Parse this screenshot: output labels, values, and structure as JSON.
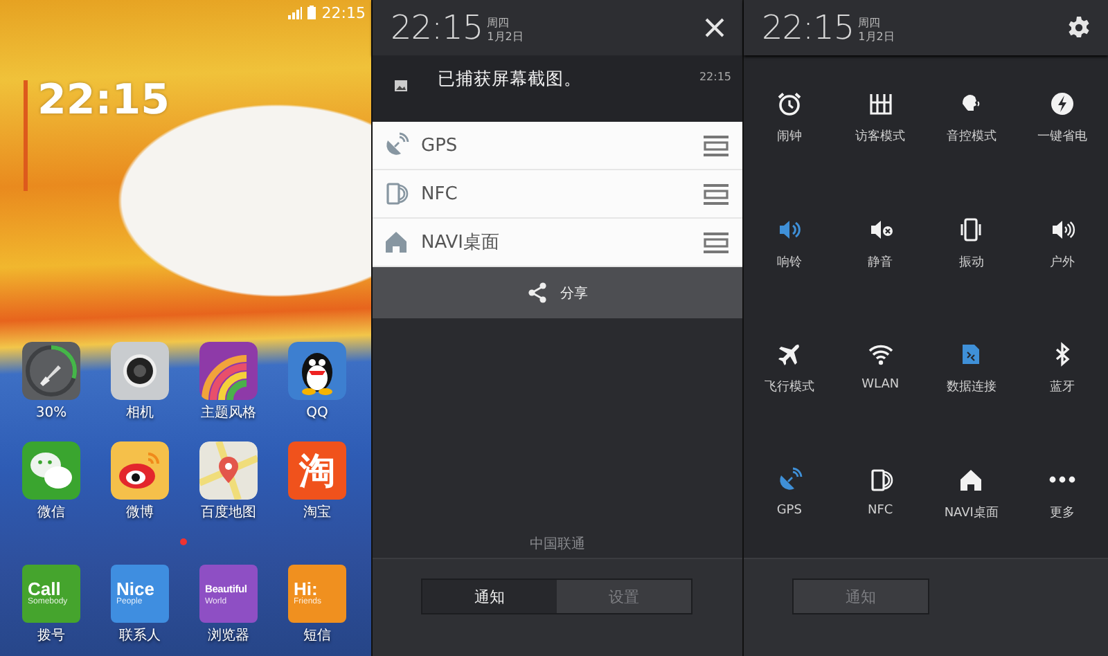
{
  "home_screen": {
    "status_bar": {
      "time": "22:15"
    },
    "clock": "22:15",
    "apps": [
      {
        "label": "30%",
        "level": 0.3
      },
      {
        "label": "相机"
      },
      {
        "label": "主题风格"
      },
      {
        "label": "QQ"
      },
      {
        "label": "微信"
      },
      {
        "label": "微博"
      },
      {
        "label": "百度地图"
      },
      {
        "label": "淘宝",
        "icon_text": "淘"
      }
    ],
    "dock": [
      {
        "label": "拨号",
        "icon_title": "Call",
        "icon_subtitle": "Somebody"
      },
      {
        "label": "联系人",
        "icon_title": "Nice",
        "icon_subtitle": "People"
      },
      {
        "label": "浏览器",
        "icon_title": "Beautiful",
        "icon_subtitle": "World"
      },
      {
        "label": "短信",
        "icon_title": "Hi:",
        "icon_subtitle": "Friends"
      }
    ]
  },
  "notification_panel": {
    "header": {
      "time": "22:15",
      "weekday": "周四",
      "date": "1月2日"
    },
    "notification": {
      "text": "已捕获屏幕截图。",
      "time": "22:15"
    },
    "menu": {
      "items": [
        {
          "label": "GPS"
        },
        {
          "label": "NFC"
        },
        {
          "label": "NAVI桌面"
        }
      ],
      "share": "分享"
    },
    "carrier": "中国联通",
    "tabs": [
      {
        "label": "通知",
        "selected": true
      },
      {
        "label": "设置",
        "selected": false
      }
    ]
  },
  "quick_settings": {
    "header": {
      "time": "22:15",
      "weekday": "周四",
      "date": "1月2日"
    },
    "toggles": [
      {
        "label": "闹钟",
        "on": false
      },
      {
        "label": "访客模式",
        "on": false
      },
      {
        "label": "音控模式",
        "on": false
      },
      {
        "label": "一键省电",
        "on": false
      },
      {
        "label": "响铃",
        "on": true
      },
      {
        "label": "静音",
        "on": false
      },
      {
        "label": "振动",
        "on": false
      },
      {
        "label": "户外",
        "on": false
      },
      {
        "label": "飞行模式",
        "on": false
      },
      {
        "label": "WLAN",
        "on": false
      },
      {
        "label": "数据连接",
        "on": true
      },
      {
        "label": "蓝牙",
        "on": false
      },
      {
        "label": "GPS",
        "on": true
      },
      {
        "label": "NFC",
        "on": false
      },
      {
        "label": "NAVI桌面",
        "on": false
      },
      {
        "label": "更多",
        "on": false
      }
    ],
    "tabs": [
      {
        "label": "通知",
        "selected": false
      }
    ]
  }
}
